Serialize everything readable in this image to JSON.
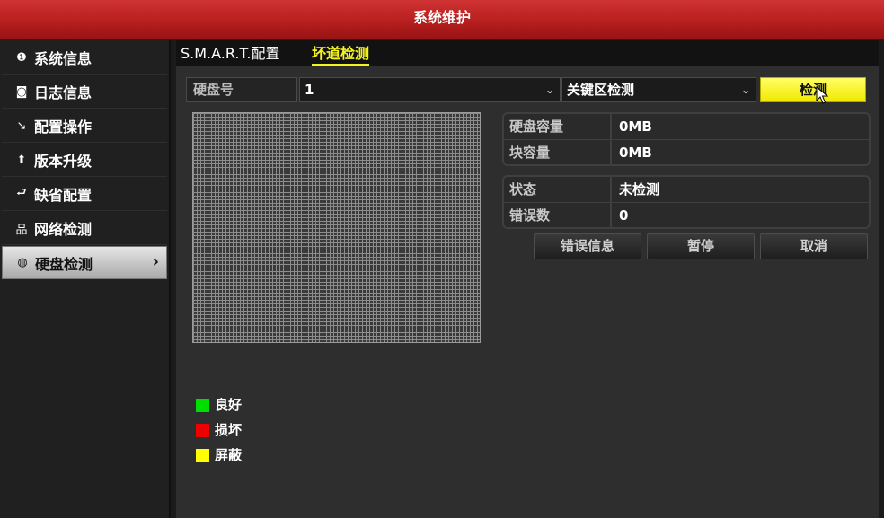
{
  "window": {
    "title": "系统维护"
  },
  "sidebar": {
    "items": [
      {
        "label": "系统信息",
        "icon": "info-icon",
        "glyph": "❶"
      },
      {
        "label": "日志信息",
        "icon": "log-icon",
        "glyph": "◙"
      },
      {
        "label": "配置操作",
        "icon": "config-icon",
        "glyph": "↘"
      },
      {
        "label": "版本升级",
        "icon": "upgrade-icon",
        "glyph": "⬆"
      },
      {
        "label": "缺省配置",
        "icon": "default-icon",
        "glyph": "⮐"
      },
      {
        "label": "网络检测",
        "icon": "network-icon",
        "glyph": "品"
      },
      {
        "label": "硬盘检测",
        "icon": "hdd-check-icon",
        "glyph": "◍",
        "active": true
      }
    ],
    "active_chevron": "›"
  },
  "tabs": [
    {
      "label": "S.M.A.R.T.配置"
    },
    {
      "label": "坏道检测",
      "active": true
    }
  ],
  "controls": {
    "hdd_label": "硬盘号",
    "hdd_value": "1",
    "mode_value": "关键区检测",
    "detect_button": "检测",
    "chevron": "⌄"
  },
  "info": {
    "capacity_label": "硬盘容量",
    "capacity_value": "0MB",
    "block_label": "块容量",
    "block_value": "0MB",
    "status_label": "状态",
    "status_value": "未检测",
    "errors_label": "错误数",
    "errors_value": "0"
  },
  "buttons": {
    "error_info": "错误信息",
    "pause": "暂停",
    "cancel": "取消"
  },
  "legend": [
    {
      "label": "良好",
      "color": "#00dd00"
    },
    {
      "label": "损坏",
      "color": "#ee0000"
    },
    {
      "label": "屏蔽",
      "color": "#ffff00"
    }
  ]
}
